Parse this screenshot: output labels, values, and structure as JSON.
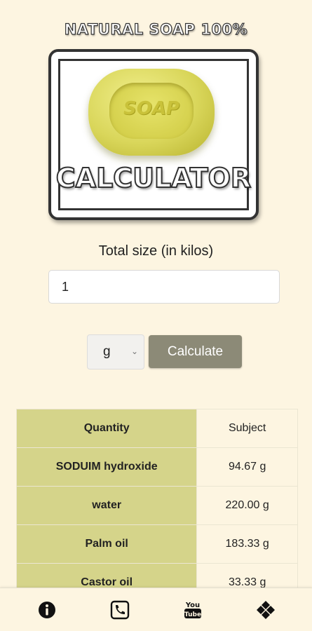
{
  "header": {
    "title": "NATURAL SOAP 100%",
    "logo_soap_text": "SOAP",
    "logo_calculator_text": "CALCULATOR"
  },
  "form": {
    "size_label": "Total size (in kilos)",
    "size_value": "1",
    "unit_selected": "g",
    "calculate_label": "Calculate"
  },
  "table": {
    "headers": [
      "Quantity",
      "Subject"
    ],
    "rows": [
      {
        "name": "SODUIM hydroxide",
        "value": "94.67 g"
      },
      {
        "name": "water",
        "value": "220.00 g"
      },
      {
        "name": "Palm oil",
        "value": "183.33 g"
      },
      {
        "name": "Castor oil",
        "value": "33.33 g"
      }
    ]
  },
  "bottom_nav": {
    "items": [
      "info-icon",
      "phone-icon",
      "youtube-icon",
      "apps-icon"
    ]
  },
  "colors": {
    "background": "#fdf5e1",
    "table_left": "#d5d48a",
    "button": "#8c8a77"
  }
}
